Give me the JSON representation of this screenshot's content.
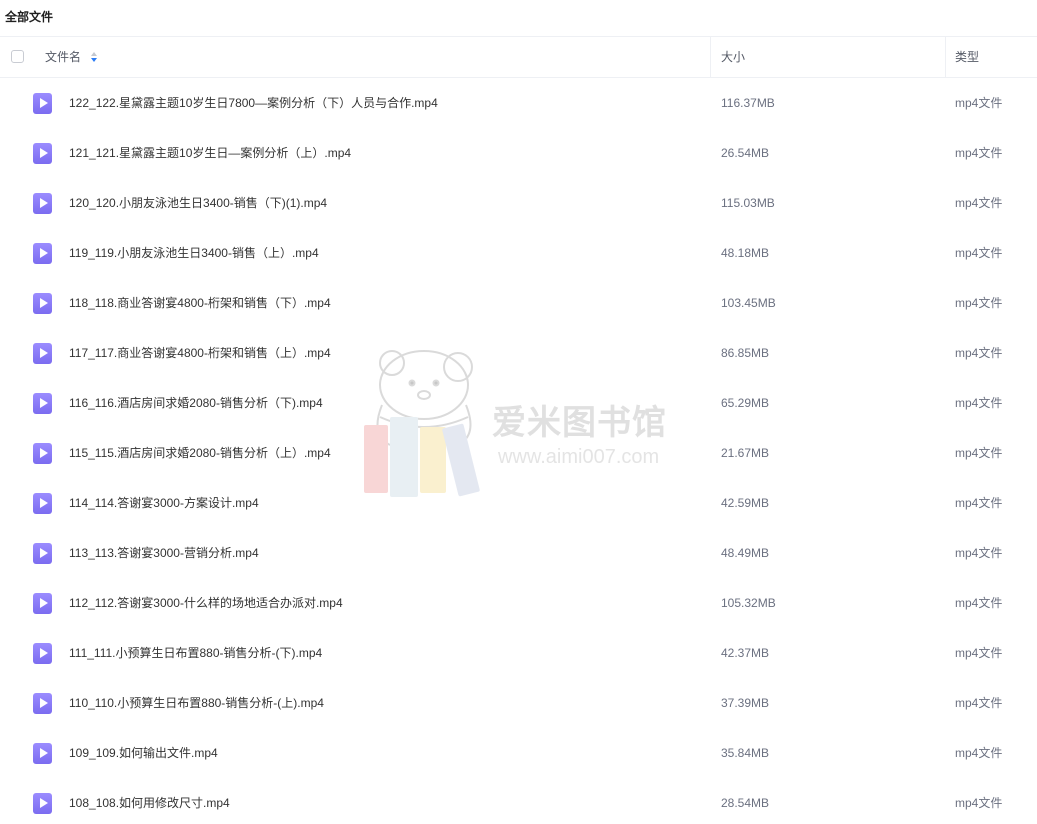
{
  "breadcrumb": {
    "label": "全部文件"
  },
  "header": {
    "name_label": "文件名",
    "size_label": "大小",
    "type_label": "类型"
  },
  "colors": {
    "file_icon": "#8b7cf8",
    "border": "#eef0f4",
    "sort_icon": "#2a7cf6"
  },
  "files": [
    {
      "name": "122_122.星黛露主题10岁生日7800—案例分析（下）人员与合作.mp4",
      "size": "116.37MB",
      "type": "mp4文件",
      "icon": "video-file-icon"
    },
    {
      "name": "121_121.星黛露主题10岁生日—案例分析（上）.mp4",
      "size": "26.54MB",
      "type": "mp4文件",
      "icon": "video-file-icon"
    },
    {
      "name": "120_120.小朋友泳池生日3400-销售（下)(1).mp4",
      "size": "115.03MB",
      "type": "mp4文件",
      "icon": "video-file-icon"
    },
    {
      "name": "119_119.小朋友泳池生日3400-销售（上）.mp4",
      "size": "48.18MB",
      "type": "mp4文件",
      "icon": "video-file-icon"
    },
    {
      "name": "118_118.商业答谢宴4800-桁架和销售（下）.mp4",
      "size": "103.45MB",
      "type": "mp4文件",
      "icon": "video-file-icon"
    },
    {
      "name": "117_117.商业答谢宴4800-桁架和销售（上）.mp4",
      "size": "86.85MB",
      "type": "mp4文件",
      "icon": "video-file-icon"
    },
    {
      "name": "116_116.酒店房间求婚2080-销售分析（下).mp4",
      "size": "65.29MB",
      "type": "mp4文件",
      "icon": "video-file-icon"
    },
    {
      "name": "115_115.酒店房间求婚2080-销售分析（上）.mp4",
      "size": "21.67MB",
      "type": "mp4文件",
      "icon": "video-file-icon"
    },
    {
      "name": "114_114.答谢宴3000-方案设计.mp4",
      "size": "42.59MB",
      "type": "mp4文件",
      "icon": "video-file-icon"
    },
    {
      "name": "113_113.答谢宴3000-营销分析.mp4",
      "size": "48.49MB",
      "type": "mp4文件",
      "icon": "video-file-icon"
    },
    {
      "name": "112_112.答谢宴3000-什么样的场地适合办派对.mp4",
      "size": "105.32MB",
      "type": "mp4文件",
      "icon": "video-file-icon"
    },
    {
      "name": "111_111.小预算生日布置880-销售分析-(下).mp4",
      "size": "42.37MB",
      "type": "mp4文件",
      "icon": "video-file-icon"
    },
    {
      "name": "110_110.小预算生日布置880-销售分析-(上).mp4",
      "size": "37.39MB",
      "type": "mp4文件",
      "icon": "video-file-icon"
    },
    {
      "name": "109_109.如何输出文件.mp4",
      "size": "35.84MB",
      "type": "mp4文件",
      "icon": "video-file-icon"
    },
    {
      "name": "108_108.如何用修改尺寸.mp4",
      "size": "28.54MB",
      "type": "mp4文件",
      "icon": "video-file-icon"
    }
  ],
  "watermark": {
    "title": "爱米图书馆",
    "url": "www.aimi007.com"
  }
}
